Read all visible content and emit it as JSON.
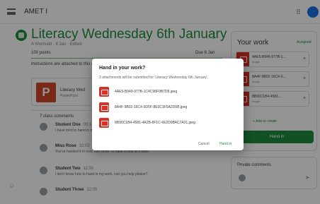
{
  "header": {
    "class_name": "AMET I",
    "apps_glyph": "⠿"
  },
  "assignment": {
    "title": "Literacy Wednesday 6th January",
    "meta": "A Wormald · 6 Jan · Edited",
    "points": "100 points",
    "due": "Due 6 Jan",
    "instructions": "Instructions are attached to this assignment.",
    "attachment_title": "Literacy Wed",
    "attachment_type": "PowerPoint",
    "more_glyph": "⋮"
  },
  "comments": {
    "heading": "7 class comments",
    "items": [
      {
        "author": "Student One",
        "time": "09:14",
        "text": "I have tried to hand in my work but it doesn't say anything."
      },
      {
        "author": "Miss Rose",
        "time": "10:02",
        "text": "You've handed it in now, well done. I'll have a look at it soon."
      },
      {
        "author": "Student Two",
        "time": "11:30",
        "text": "I don't know how to hand in my work, can you help please?"
      },
      {
        "author": "Student Three",
        "time": "12:05",
        "text": ""
      }
    ]
  },
  "work": {
    "title": "Your work",
    "status": "Assigned",
    "files": [
      {
        "name": "4AE5-B949-977B-1...",
        "type": "Image"
      },
      {
        "name": "8A4F-9B02-16C4-9...",
        "type": "Image"
      },
      {
        "name": "8B90C1B4-4581-...",
        "type": "Image"
      }
    ],
    "add_create": "+ Add or create",
    "hand_in_button": "Hand in",
    "remove_glyph": "×"
  },
  "private_comments": {
    "title": "Private comments",
    "send_glyph": "➤"
  },
  "modal": {
    "title": "Hand in your work?",
    "description": "3 attachments will be submitted for 'Literacy Wednesday 6th January'.",
    "files": [
      "4AE5-B949-977B-1C4C98F9B7D8.jpeg",
      "8A4F-9B02-16C4-9D5F-8E0C1F5A2D6B.jpeg",
      "8B90C1B4-4581-4A2B-8F1C-6E2D9B4C7A31.jpeg"
    ],
    "cancel_label": "Cancel",
    "hand_in_label": "Hand in"
  }
}
